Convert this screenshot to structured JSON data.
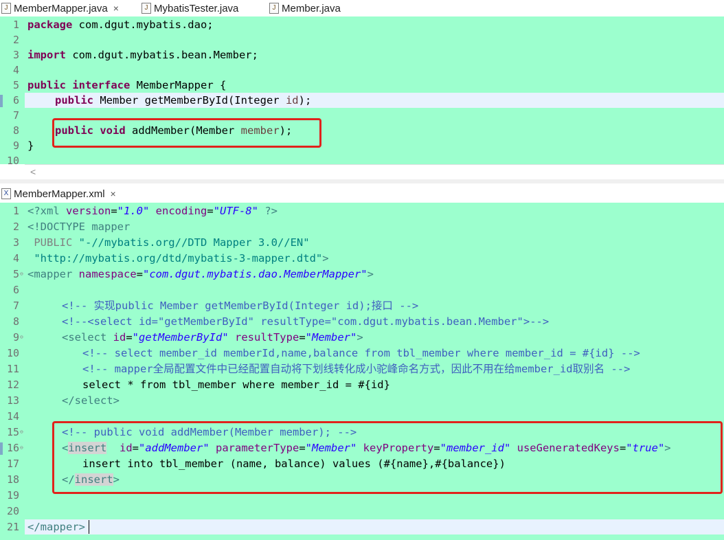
{
  "java_tabs": [
    {
      "label": "MemberMapper.java",
      "close": "×",
      "icon": "J"
    },
    {
      "label": "MybatisTester.java",
      "icon": "J"
    },
    {
      "label": "Member.java",
      "icon": "J"
    }
  ],
  "xml_tab": {
    "label": "MemberMapper.xml",
    "close": "×",
    "icon": "X"
  },
  "java_scroll_glyph": "<",
  "java_line_numbers": [
    "1",
    "2",
    "3",
    "4",
    "5",
    "6",
    "7",
    "8",
    "9",
    "10"
  ],
  "xml_line_numbers": [
    "1",
    "2",
    "3",
    "4",
    "5",
    "6",
    "7",
    "8",
    "9",
    "10",
    "11",
    "12",
    "13",
    "14",
    "15",
    "16",
    "17",
    "18",
    "19",
    "20",
    "21"
  ],
  "java": {
    "l1_kw": "package",
    "l1_rest": " com.dgut.mybatis.dao;",
    "l3_kw": "import",
    "l3_rest": " com.dgut.mybatis.bean.Member;",
    "l5_kw1": "public",
    "l5_kw2": "interface",
    "l5_rest": " MemberMapper {",
    "l6_kw": "public",
    "l6_mid": " Member getMemberById(Integer ",
    "l6_par": "id",
    "l6_end": ");",
    "l8_kw1": "public",
    "l8_kw2": "void",
    "l8_mid": " addMember(Member ",
    "l8_par": "member",
    "l8_end": ");",
    "l9": "}"
  },
  "xml": {
    "l1_a": "<?xml ",
    "l1_b": "version",
    "l1_c": "=",
    "l1_d": "\"1.0\"",
    "l1_e": " encoding",
    "l1_f": "=",
    "l1_g": "\"UTF-8\"",
    "l1_h": " ?>",
    "l2": "<!DOCTYPE mapper",
    "l3_a": " PUBLIC ",
    "l3_b": "\"-//mybatis.org//DTD Mapper 3.0//EN\"",
    "l4_a": " \"http://mybatis.org/dtd/mybatis-3-mapper.dtd\"",
    "l4_b": ">",
    "l5_a": "<mapper",
    "l5_b": " namespace",
    "l5_c": "=",
    "l5_d": "\"com.dgut.mybatis.dao.MemberMapper\"",
    "l5_e": ">",
    "l7": "<!-- 实现public Member getMemberById(Integer id);接口 -->",
    "l8": "<!--<select id=\"getMemberById\" resultType=\"com.dgut.mybatis.bean.Member\">-->",
    "l9_a": "<select",
    "l9_b": " id",
    "l9_c": "=",
    "l9_d": "\"getMemberById\"",
    "l9_e": " resultType",
    "l9_f": "=",
    "l9_g": "\"Member\"",
    "l9_h": ">",
    "l10": "<!-- select member_id memberId,name,balance from tbl_member where member_id = #{id} -->",
    "l11": "<!-- mapper全局配置文件中已经配置自动将下划线转化成小驼峰命名方式，因此不用在给member_id取别名 -->",
    "l12": "select * from tbl_member where member_id = #{id}",
    "l13": "</select>",
    "l15": "<!-- public void addMember(Member member); -->",
    "l16_a": "<",
    "l16_b": "insert",
    "l16_c": "  id",
    "l16_d": "=",
    "l16_e": "\"addMember\"",
    "l16_f": " parameterType",
    "l16_g": "=",
    "l16_h": "\"Member\"",
    "l16_i": " keyProperty",
    "l16_j": "=",
    "l16_k": "\"member_id\"",
    "l16_l": " useGeneratedKeys",
    "l16_m": "=",
    "l16_n": "\"true\"",
    "l16_o": ">",
    "l17": "insert into tbl_member (name, balance) values (#{name},#{balance})",
    "l18_a": "</",
    "l18_b": "insert",
    "l18_c": ">",
    "l21": "</mapper>"
  }
}
